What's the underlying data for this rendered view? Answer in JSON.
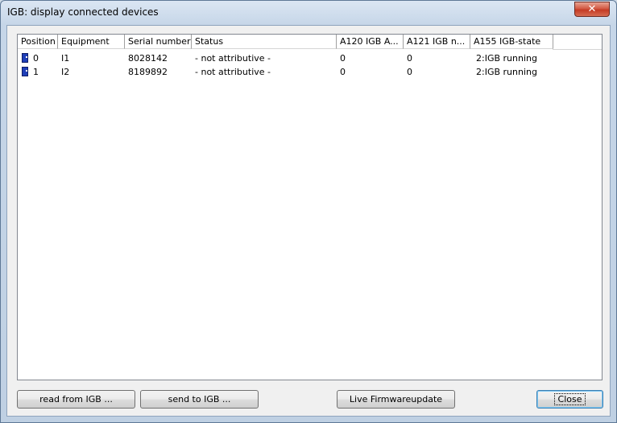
{
  "window": {
    "title": "IGB: display connected devices",
    "close_glyph": "✕"
  },
  "columns": [
    "Position",
    "Equipment",
    "Serial number",
    "Status",
    "A120 IGB A...",
    "A121 IGB n...",
    "A155 IGB-state"
  ],
  "rows": [
    {
      "icon": "device-icon",
      "position": "0",
      "equipment": "I1",
      "serial": "8028142",
      "status": "- not attributive -",
      "a120": "0",
      "a121": "0",
      "a155": "2:IGB running"
    },
    {
      "icon": "device-icon",
      "position": "1",
      "equipment": "I2",
      "serial": "8189892",
      "status": "- not attributive -",
      "a120": "0",
      "a121": "0",
      "a155": "2:IGB running"
    }
  ],
  "buttons": {
    "read": "read from IGB ...",
    "send": "send to IGB ...",
    "firmware": "Live Firmwareupdate",
    "close": "Close"
  }
}
